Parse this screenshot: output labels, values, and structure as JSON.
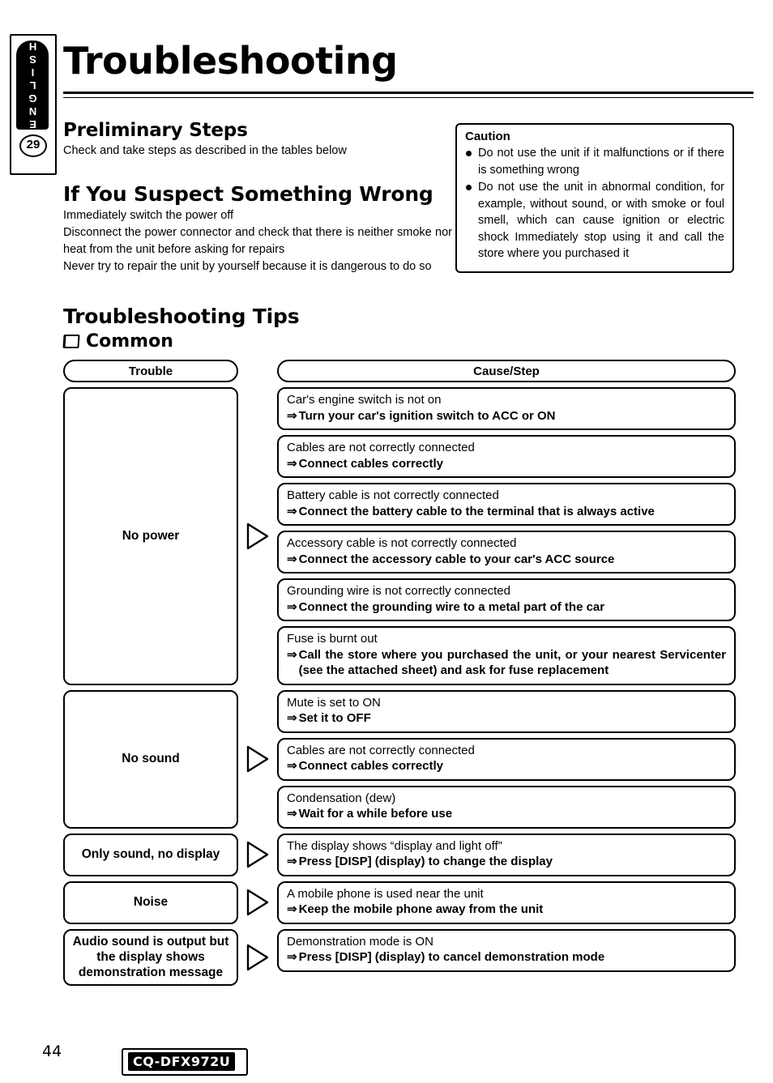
{
  "side_tab": {
    "language": "ENGLISH",
    "number": "29"
  },
  "title": "Troubleshooting",
  "preliminary": {
    "heading": "Preliminary Steps",
    "text": "Check and take steps as described in the tables below"
  },
  "suspect": {
    "heading": "If You Suspect Something Wrong",
    "line1": "Immediately switch the power off",
    "line2": "Disconnect the power connector and check that there is neither smoke nor heat from the unit before asking for repairs",
    "line3": "Never try to repair the unit by yourself because it is dangerous to do so"
  },
  "caution": {
    "title": "Caution",
    "items": [
      "Do not use the unit if it malfunctions or if there is something wrong",
      "Do not use the unit in abnormal condition, for example, without sound, or with smoke or foul smell, which can cause ignition or electric shock  Immediately stop using it and call the store where you purchased it"
    ]
  },
  "tips": {
    "heading": "Troubleshooting Tips",
    "subheading": "Common"
  },
  "table": {
    "headers": {
      "trouble": "Trouble",
      "cause": "Cause/Step"
    },
    "arrow_symbol": "⇒",
    "groups": [
      {
        "trouble": "No power",
        "rows": [
          {
            "cause": "Car's engine switch is not on",
            "step": "Turn your car's ignition switch to ACC or ON"
          },
          {
            "cause": "Cables are not correctly connected",
            "step": "Connect cables correctly"
          },
          {
            "cause": "Battery cable is not correctly connected",
            "step": "Connect the battery cable to the terminal that is always active"
          },
          {
            "cause": "Accessory cable is not correctly connected",
            "step": "Connect the accessory cable to your car's ACC source"
          },
          {
            "cause": "Grounding wire is not correctly connected",
            "step": "Connect the grounding wire to a metal part of the car"
          },
          {
            "cause": "Fuse is burnt out",
            "step": "Call the store where you purchased the unit, or your nearest Servicenter (see the attached sheet) and ask for fuse replacement"
          }
        ]
      },
      {
        "trouble": "No sound",
        "rows": [
          {
            "cause": "Mute is set to ON",
            "step": "Set it to OFF"
          },
          {
            "cause": "Cables are not correctly connected",
            "step": "Connect cables correctly"
          },
          {
            "cause": "Condensation (dew)",
            "step": "Wait for a while before use"
          }
        ]
      },
      {
        "trouble": "Only sound, no display",
        "rows": [
          {
            "cause": "The display shows “display and light off”",
            "step": "Press [DISP] (display) to change the display"
          }
        ]
      },
      {
        "trouble": "Noise",
        "rows": [
          {
            "cause": "A mobile phone is used near the unit",
            "step": "Keep the mobile phone away from the unit"
          }
        ]
      },
      {
        "trouble": "Audio sound is output but the display shows demonstration message",
        "rows": [
          {
            "cause": "Demonstration mode is ON",
            "step": "Press [DISP] (display) to cancel demonstration mode"
          }
        ]
      }
    ]
  },
  "footer": {
    "page_number": "44",
    "model": "CQ-DFX972U"
  }
}
